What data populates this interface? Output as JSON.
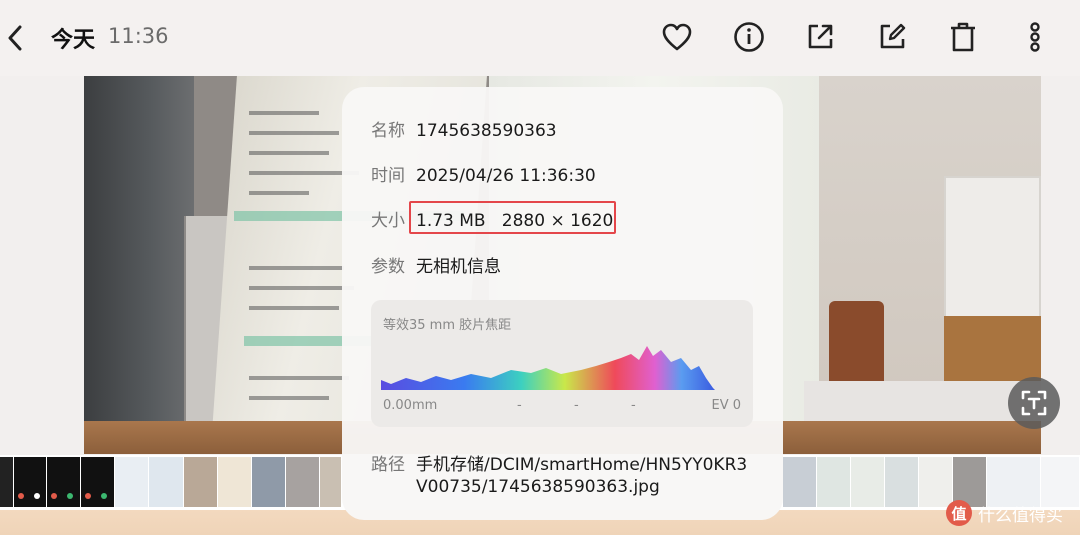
{
  "topbar": {
    "title": "今天",
    "time": "11:36",
    "icons": [
      "back-icon",
      "heart-icon",
      "info-icon",
      "share-icon",
      "edit-icon",
      "delete-icon",
      "more-icon"
    ]
  },
  "info": {
    "name_label": "名称",
    "name_value": "1745638590363",
    "time_label": "时间",
    "time_value": "2025/04/26 11:36:30",
    "size_label": "大小",
    "size_value": "1.73 MB   2880 × 1620",
    "params_label": "参数",
    "params_value": "无相机信息",
    "histogram": {
      "title": "等效35 mm 胶片焦距",
      "left_label": "0.00mm",
      "placeholders": [
        "-",
        "-",
        "-"
      ],
      "right_label": "EV 0"
    },
    "path_label": "路径",
    "path_value": "手机存储/DCIM/smartHome/HN5YY0KR3V00735/1745638590363.jpg"
  },
  "watermark": {
    "logo": "值",
    "text": "什么值得买"
  },
  "colors": {
    "highlight_border": "#e4464a",
    "accent_dots": [
      "#e25b4a",
      "#3cb870",
      "#ffffff"
    ]
  }
}
